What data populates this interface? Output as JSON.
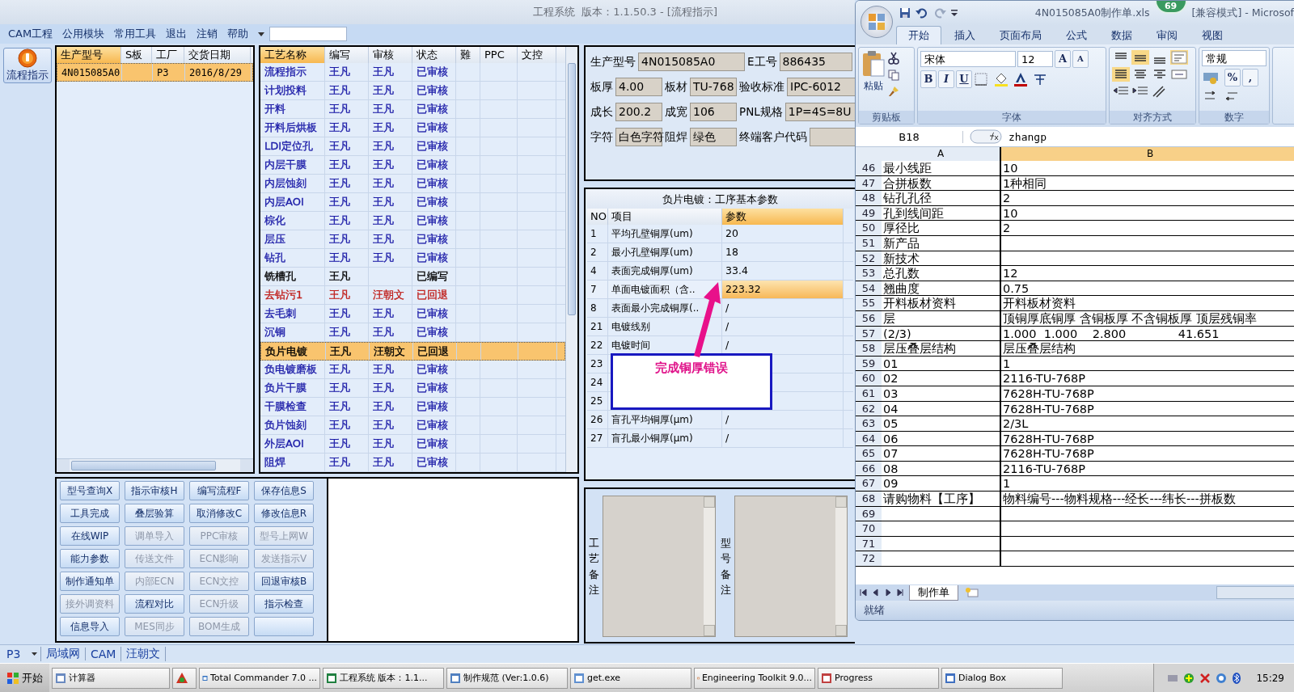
{
  "window": {
    "title": "工程系统  版本：1.1.50.3 - [流程指示]"
  },
  "menu": {
    "items": [
      "CAM工程",
      "公用模块",
      "常用工具",
      "退出",
      "注销",
      "帮助"
    ]
  },
  "side_button": {
    "label": "流程指示"
  },
  "product_table": {
    "columns": [
      "生产型号",
      "S板",
      "工厂",
      "交货日期"
    ],
    "rows": [
      {
        "cells": [
          "4N015085A0",
          "",
          "P3",
          "2016/8/29"
        ],
        "selected": true
      }
    ]
  },
  "process_table": {
    "columns": [
      "工艺名称",
      "编写",
      "审核",
      "状态",
      "難",
      "PPC",
      "文控"
    ],
    "rows": [
      {
        "cells": [
          "流程指示",
          "王凡",
          "王凡",
          "已审核"
        ],
        "color": "#1c1ca8",
        "selected": false
      },
      {
        "cells": [
          "计划投料",
          "王凡",
          "王凡",
          "已审核"
        ],
        "color": "#1c1ca8",
        "selected": false
      },
      {
        "cells": [
          "开料",
          "王凡",
          "王凡",
          "已审核"
        ],
        "color": "#1c1ca8",
        "selected": false
      },
      {
        "cells": [
          "开料后烘板",
          "王凡",
          "王凡",
          "已审核"
        ],
        "color": "#1c1ca8",
        "selected": false
      },
      {
        "cells": [
          "LDI定位孔",
          "王凡",
          "王凡",
          "已审核"
        ],
        "color": "#1c1ca8",
        "selected": false
      },
      {
        "cells": [
          "内层干膜",
          "王凡",
          "王凡",
          "已审核"
        ],
        "color": "#1c1ca8",
        "selected": false
      },
      {
        "cells": [
          "内层蚀刻",
          "王凡",
          "王凡",
          "已审核"
        ],
        "color": "#1c1ca8",
        "selected": false
      },
      {
        "cells": [
          "内层AOI",
          "王凡",
          "王凡",
          "已审核"
        ],
        "color": "#1c1ca8",
        "selected": false
      },
      {
        "cells": [
          "棕化",
          "王凡",
          "王凡",
          "已审核"
        ],
        "color": "#1c1ca8",
        "selected": false
      },
      {
        "cells": [
          "层压",
          "王凡",
          "王凡",
          "已审核"
        ],
        "color": "#1c1ca8",
        "selected": false
      },
      {
        "cells": [
          "钻孔",
          "王凡",
          "王凡",
          "已审核"
        ],
        "color": "#1c1ca8",
        "selected": false
      },
      {
        "cells": [
          "铣槽孔",
          "王凡",
          "",
          "已编写"
        ],
        "color": "#000000",
        "selected": false
      },
      {
        "cells": [
          "去钻污1",
          "王凡",
          "汪朝文",
          "已回退"
        ],
        "color": "#c0201c",
        "selected": false
      },
      {
        "cells": [
          "去毛刺",
          "王凡",
          "王凡",
          "已审核"
        ],
        "color": "#1c1ca8",
        "selected": false
      },
      {
        "cells": [
          "沉铜",
          "王凡",
          "王凡",
          "已审核"
        ],
        "color": "#1c1ca8",
        "selected": false
      },
      {
        "cells": [
          "负片电镀",
          "王凡",
          "汪朝文",
          "已回退"
        ],
        "selected": true
      },
      {
        "cells": [
          "负电镀磨板",
          "王凡",
          "王凡",
          "已审核"
        ],
        "color": "#1c1ca8",
        "selected": false
      },
      {
        "cells": [
          "负片干膜",
          "王凡",
          "王凡",
          "已审核"
        ],
        "color": "#1c1ca8",
        "selected": false
      },
      {
        "cells": [
          "干膜检查",
          "王凡",
          "王凡",
          "已审核"
        ],
        "color": "#1c1ca8",
        "selected": false
      },
      {
        "cells": [
          "负片蚀刻",
          "王凡",
          "王凡",
          "已审核"
        ],
        "color": "#1c1ca8",
        "selected": false
      },
      {
        "cells": [
          "外层AOI",
          "王凡",
          "王凡",
          "已审核"
        ],
        "color": "#1c1ca8",
        "selected": false
      },
      {
        "cells": [
          "阻焊",
          "王凡",
          "王凡",
          "已审核"
        ],
        "color": "#1c1ca8",
        "selected": false
      }
    ]
  },
  "info_form": {
    "fields": [
      {
        "label": "生产型号",
        "value": "4N015085A0"
      },
      {
        "label": "E工号",
        "value": "886435"
      },
      {
        "label": "板厚",
        "value": "4.00"
      },
      {
        "label": "板材",
        "value": "TU-768"
      },
      {
        "label": "验收标准",
        "value": "IPC-6012"
      },
      {
        "label": "成长",
        "value": "200.2"
      },
      {
        "label": "成宽",
        "value": "106"
      },
      {
        "label": "PNL规格",
        "value": "1P=4S=8U"
      },
      {
        "label": "字符",
        "value": "白色字符"
      },
      {
        "label": "阻焊",
        "value": "绿色"
      },
      {
        "label": "终端客户代码"
      }
    ]
  },
  "param_table": {
    "title": "负片电镀：工序基本参数",
    "columns": [
      "NO",
      "项目",
      "参数"
    ],
    "rows": [
      {
        "no": "1",
        "item": "平均孔壁铜厚(um)",
        "value": "20",
        "selected": false
      },
      {
        "no": "2",
        "item": "最小孔壁铜厚(um)",
        "value": "18",
        "selected": false
      },
      {
        "no": "4",
        "item": "表面完成铜厚(um)",
        "value": "33.4",
        "selected": false
      },
      {
        "no": "7",
        "item": "单面电镀面积（含..",
        "value": "223.32",
        "selected": true
      },
      {
        "no": "8",
        "item": "表面最小完成铜厚(..",
        "value": "/",
        "selected": false
      },
      {
        "no": "21",
        "item": "电镀线别",
        "value": "/",
        "selected": false
      },
      {
        "no": "22",
        "item": "电镀时间",
        "value": "/",
        "selected": false
      },
      {
        "no": "23",
        "selected": false
      },
      {
        "no": "24",
        "selected": false
      },
      {
        "no": "25",
        "selected": false
      },
      {
        "no": "26",
        "item": "盲孔平均铜厚(μm)",
        "value": "/",
        "selected": false
      },
      {
        "no": "27",
        "item": "盲孔最小铜厚(μm)",
        "value": "/",
        "selected": false
      }
    ]
  },
  "callout": {
    "text": "完成铜厚错误"
  },
  "buttons": [
    {
      "label": "型号查询X",
      "disabled": false
    },
    {
      "label": "指示审核H",
      "disabled": false
    },
    {
      "label": "编写流程F",
      "disabled": false
    },
    {
      "label": "保存信息S",
      "disabled": false
    },
    {
      "label": "工具完成",
      "disabled": false
    },
    {
      "label": "叠层验算",
      "disabled": false
    },
    {
      "label": "取消修改C",
      "disabled": false
    },
    {
      "label": "修改信息R",
      "disabled": false
    },
    {
      "label": "在线WIP",
      "disabled": false
    },
    {
      "label": "调单导入",
      "disabled": true
    },
    {
      "label": "PPC审核",
      "disabled": true
    },
    {
      "label": "型号上网W",
      "disabled": true
    },
    {
      "label": "能力参数",
      "disabled": false
    },
    {
      "label": "传送文件",
      "disabled": true
    },
    {
      "label": "ECN影响",
      "disabled": true
    },
    {
      "label": "发送指示V",
      "disabled": true
    },
    {
      "label": "制作通知单",
      "disabled": false
    },
    {
      "label": "内部ECN",
      "disabled": true
    },
    {
      "label": "ECN文控",
      "disabled": true
    },
    {
      "label": "回退审核B",
      "disabled": false
    },
    {
      "label": "接外调资料",
      "disabled": true
    },
    {
      "label": "流程对比",
      "disabled": false
    },
    {
      "label": "ECN升级",
      "disabled": true
    },
    {
      "label": "指示检查",
      "disabled": false
    },
    {
      "label": "信息导入",
      "disabled": false
    },
    {
      "label": "MES同步",
      "disabled": true
    },
    {
      "label": "BOM生成",
      "disabled": true
    },
    {
      "disabled": false
    }
  ],
  "remarks": [
    {
      "label": "工艺备注"
    },
    {
      "label": "型号备注"
    }
  ],
  "status_bar": {
    "factory": "P3",
    "items": [
      "局域网",
      "CAM",
      "汪朝文"
    ]
  },
  "excel": {
    "title_file": "4N015085A0制作单.xls",
    "title_rest": "[兼容模式] - Microsof",
    "badge": "69",
    "tabs": [
      {
        "label": "开始",
        "selected": true
      },
      {
        "label": "插入",
        "selected": false
      },
      {
        "label": "页面布局",
        "selected": false
      },
      {
        "label": "公式",
        "selected": false
      },
      {
        "label": "数据",
        "selected": false
      },
      {
        "label": "审阅",
        "selected": false
      },
      {
        "label": "视图",
        "selected": false
      }
    ],
    "groups": [
      "剪贴板",
      "字体",
      "对齐方式",
      "数字"
    ],
    "paste": "粘贴",
    "font_name": "宋体",
    "font_size": "12",
    "size_buttons": [
      "A",
      "A"
    ],
    "style_buttons": [
      "B",
      "I",
      "U"
    ],
    "number_format": "常规",
    "number_buttons": [
      "%",
      ","
    ],
    "name_box": "B18",
    "formula": "zhangp",
    "columns": [
      "A",
      "B"
    ],
    "rows": [
      {
        "n": "46",
        "a": "最小线距",
        "b": "10"
      },
      {
        "n": "47",
        "a": "合拼板数",
        "b": "1种相同"
      },
      {
        "n": "48",
        "a": "钻孔孔径",
        "b": "2"
      },
      {
        "n": "49",
        "a": "孔到线间距",
        "b": "10"
      },
      {
        "n": "50",
        "a": "厚径比",
        "b": "2"
      },
      {
        "n": "51",
        "a": "新产品"
      },
      {
        "n": "52",
        "a": "新技术"
      },
      {
        "n": "53",
        "a": "总孔数",
        "b": "12"
      },
      {
        "n": "54",
        "a": "翘曲度",
        "b": "0.75"
      },
      {
        "n": "55",
        "a": "开料板材资料",
        "b": "开料板材资料"
      },
      {
        "n": "56",
        "a": "层",
        "b": "顶铜厚底铜厚 含铜板厚 不含铜板厚 顶层残铜率"
      },
      {
        "n": "57",
        "a": "(2/3)",
        "b": "1.000  1.000    2.800              41.651"
      },
      {
        "n": "58",
        "a": "层压叠层结构",
        "b": "层压叠层结构"
      },
      {
        "n": "59",
        "a": "01",
        "b": "1"
      },
      {
        "n": "60",
        "a": "02",
        "b": "2116-TU-768P"
      },
      {
        "n": "61",
        "a": "03",
        "b": "7628H-TU-768P"
      },
      {
        "n": "62",
        "a": "04",
        "b": "7628H-TU-768P"
      },
      {
        "n": "63",
        "a": "05",
        "b": "2/3L"
      },
      {
        "n": "64",
        "a": "06",
        "b": "7628H-TU-768P"
      },
      {
        "n": "65",
        "a": "07",
        "b": "7628H-TU-768P"
      },
      {
        "n": "66",
        "a": "08",
        "b": "2116-TU-768P"
      },
      {
        "n": "67",
        "a": "09",
        "b": "1"
      },
      {
        "n": "68",
        "a": "请购物料【工序】",
        "b": "物料编号---物料规格---经长---纬长---拼板数"
      },
      {
        "n": "69"
      },
      {
        "n": "70"
      },
      {
        "n": "71"
      },
      {
        "n": "72"
      }
    ],
    "sheet_tabs": [
      "制作单"
    ],
    "status": "就绪"
  },
  "taskbar": {
    "start": "开始",
    "items": [
      {
        "label": "计算器",
        "selected": false
      },
      {
        "label": "Total Commander 7.0 ...",
        "selected": false
      },
      {
        "label": "工程系统  版本：1.1...",
        "selected": false
      },
      {
        "label": "制作规范 (Ver:1.0.6)",
        "selected": false
      },
      {
        "label": "get.exe",
        "selected": false
      },
      {
        "label": "Engineering Toolkit 9.0...",
        "selected": false
      },
      {
        "label": "Progress",
        "selected": false
      },
      {
        "label": "Dialog Box",
        "selected": false
      }
    ],
    "clock": "15:29"
  }
}
